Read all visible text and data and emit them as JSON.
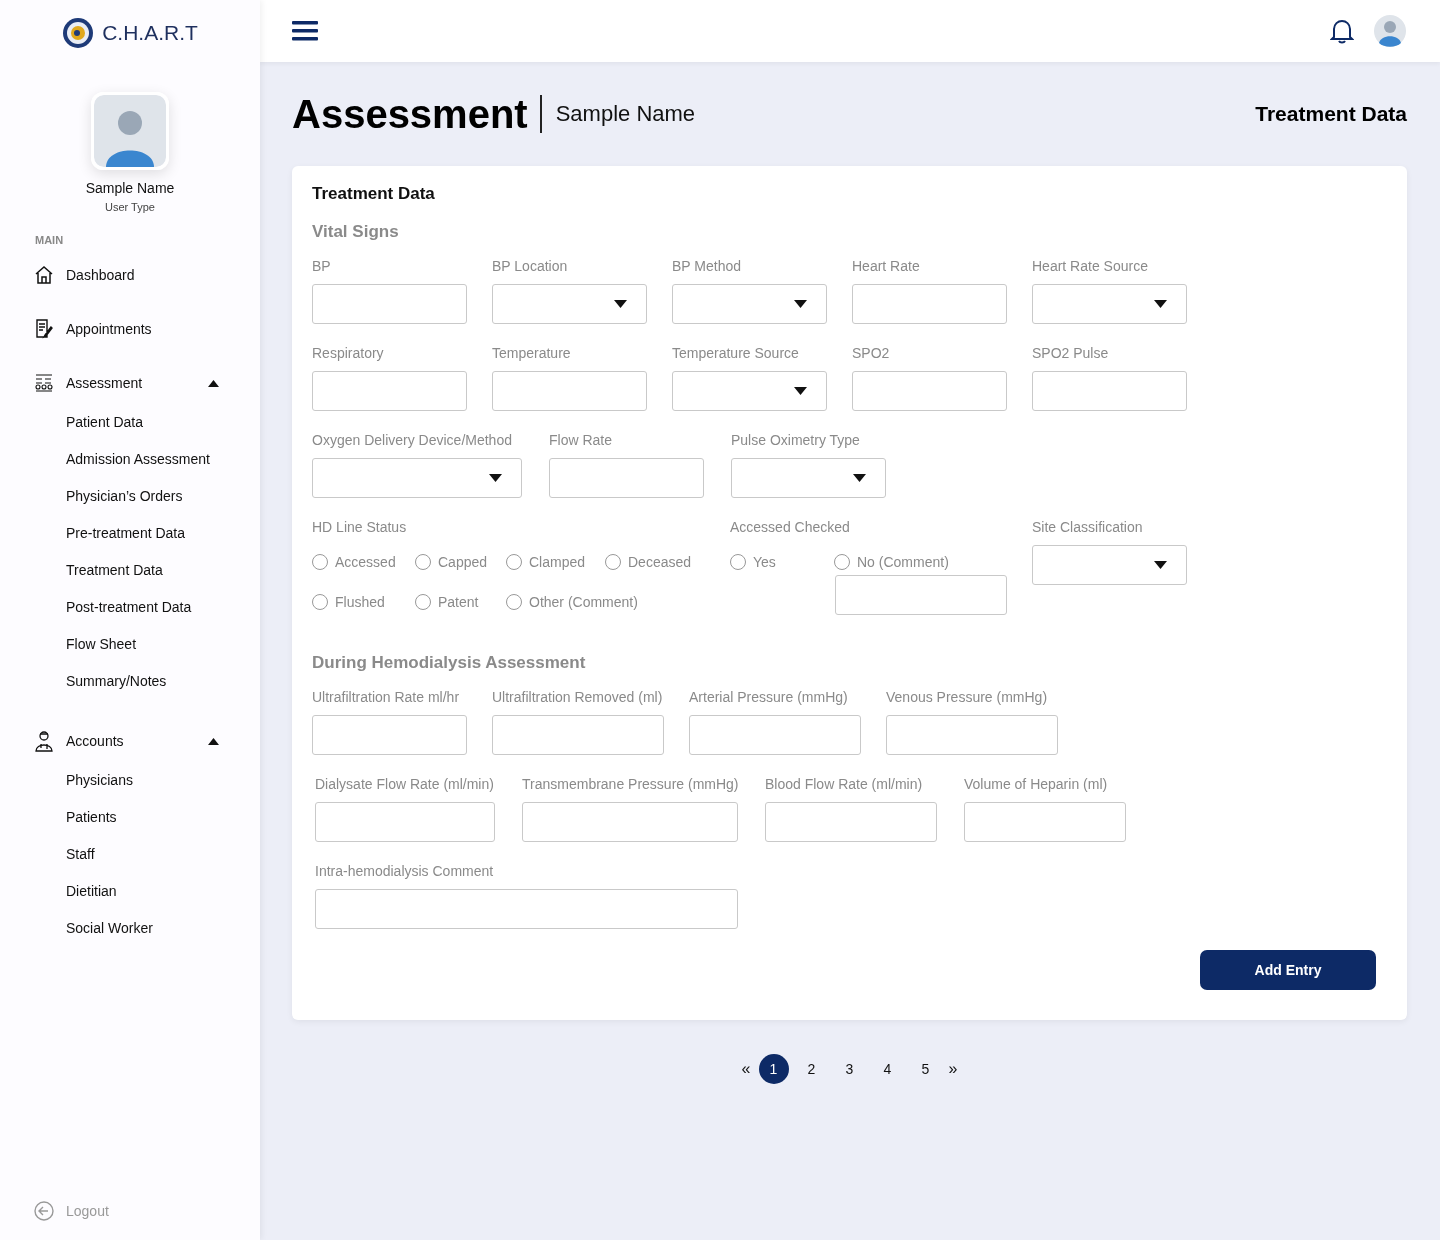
{
  "sidebar": {
    "logo_text": "C.H.A.R.T",
    "user": {
      "name": "Sample Name",
      "type": "User Type"
    },
    "section_label": "MAIN",
    "items": [
      {
        "label": "Dashboard"
      },
      {
        "label": "Appointments"
      },
      {
        "label": "Assessment",
        "expanded": true,
        "children": [
          {
            "label": "Patient Data"
          },
          {
            "label": "Admission Assessment"
          },
          {
            "label": "Physician’s Orders"
          },
          {
            "label": "Pre-treatment Data"
          },
          {
            "label": "Treatment Data"
          },
          {
            "label": "Post-treatment Data"
          },
          {
            "label": "Flow Sheet"
          },
          {
            "label": "Summary/Notes"
          }
        ]
      },
      {
        "label": "Accounts",
        "expanded": true,
        "children": [
          {
            "label": "Physicians"
          },
          {
            "label": "Patients"
          },
          {
            "label": "Staff"
          },
          {
            "label": "Dietitian"
          },
          {
            "label": "Social Worker"
          }
        ]
      }
    ],
    "logout": "Logout"
  },
  "header": {
    "title": "Assessment",
    "subtitle": "Sample Name",
    "right_title": "Treatment Data"
  },
  "card": {
    "title": "Treatment Data",
    "vital_signs": {
      "heading": "Vital Signs",
      "rows": [
        [
          {
            "label": "BP",
            "kind": "text"
          },
          {
            "label": "BP Location",
            "kind": "select"
          },
          {
            "label": "BP Method",
            "kind": "select"
          },
          {
            "label": "Heart Rate",
            "kind": "text"
          },
          {
            "label": "Heart Rate Source",
            "kind": "select"
          }
        ],
        [
          {
            "label": "Respiratory",
            "kind": "text"
          },
          {
            "label": "Temperature",
            "kind": "text"
          },
          {
            "label": "Temperature Source",
            "kind": "select"
          },
          {
            "label": "SPO2",
            "kind": "text"
          },
          {
            "label": "SPO2 Pulse",
            "kind": "text"
          }
        ],
        [
          {
            "label": "Oxygen Delivery Device/Method",
            "kind": "select"
          },
          {
            "label": "Flow Rate",
            "kind": "text"
          },
          {
            "label": "Pulse Oximetry Type",
            "kind": "select"
          }
        ]
      ]
    },
    "hd_line_status": {
      "label": "HD Line Status",
      "options": [
        [
          {
            "label": "Accessed",
            "selected": false
          },
          {
            "label": "Capped",
            "selected": false
          },
          {
            "label": "Clamped",
            "selected": false
          },
          {
            "label": "Deceased",
            "selected": false
          }
        ],
        [
          {
            "label": "Flushed",
            "selected": false
          },
          {
            "label": "Patent",
            "selected": false
          },
          {
            "label": "Other (Comment)",
            "selected": false
          }
        ]
      ]
    },
    "accessed_checked": {
      "label": "Accessed Checked",
      "options": [
        {
          "label": "Yes",
          "selected": false
        },
        {
          "label": "No (Comment)",
          "selected": false
        }
      ]
    },
    "site_classification": {
      "label": "Site Classification",
      "kind": "select"
    },
    "hemodialysis": {
      "heading": "During Hemodialysis Assessment",
      "rows": [
        [
          {
            "label": "Ultrafiltration Rate ml/hr",
            "kind": "text"
          },
          {
            "label": "Ultrafiltration Removed (ml)",
            "kind": "text"
          },
          {
            "label": "Arterial Pressure (mmHg)",
            "kind": "text"
          },
          {
            "label": "Venous Pressure (mmHg)",
            "kind": "text"
          }
        ],
        [
          {
            "label": "Dialysate Flow Rate (ml/min)",
            "kind": "text"
          },
          {
            "label": "Transmembrane Pressure (mmHg)",
            "kind": "text"
          },
          {
            "label": "Blood Flow Rate (ml/min)",
            "kind": "text"
          },
          {
            "label": "Volume of Heparin (ml)",
            "kind": "text"
          }
        ],
        [
          {
            "label": "Intra-hemodialysis Comment",
            "kind": "text"
          }
        ]
      ]
    },
    "button": "Add Entry"
  },
  "pagination": {
    "prev": "«",
    "next": "»",
    "pages": [
      {
        "label": "1",
        "selected": true
      },
      {
        "label": "2",
        "selected": false
      },
      {
        "label": "3",
        "selected": false
      },
      {
        "label": "4",
        "selected": false
      },
      {
        "label": "5",
        "selected": false
      }
    ]
  }
}
